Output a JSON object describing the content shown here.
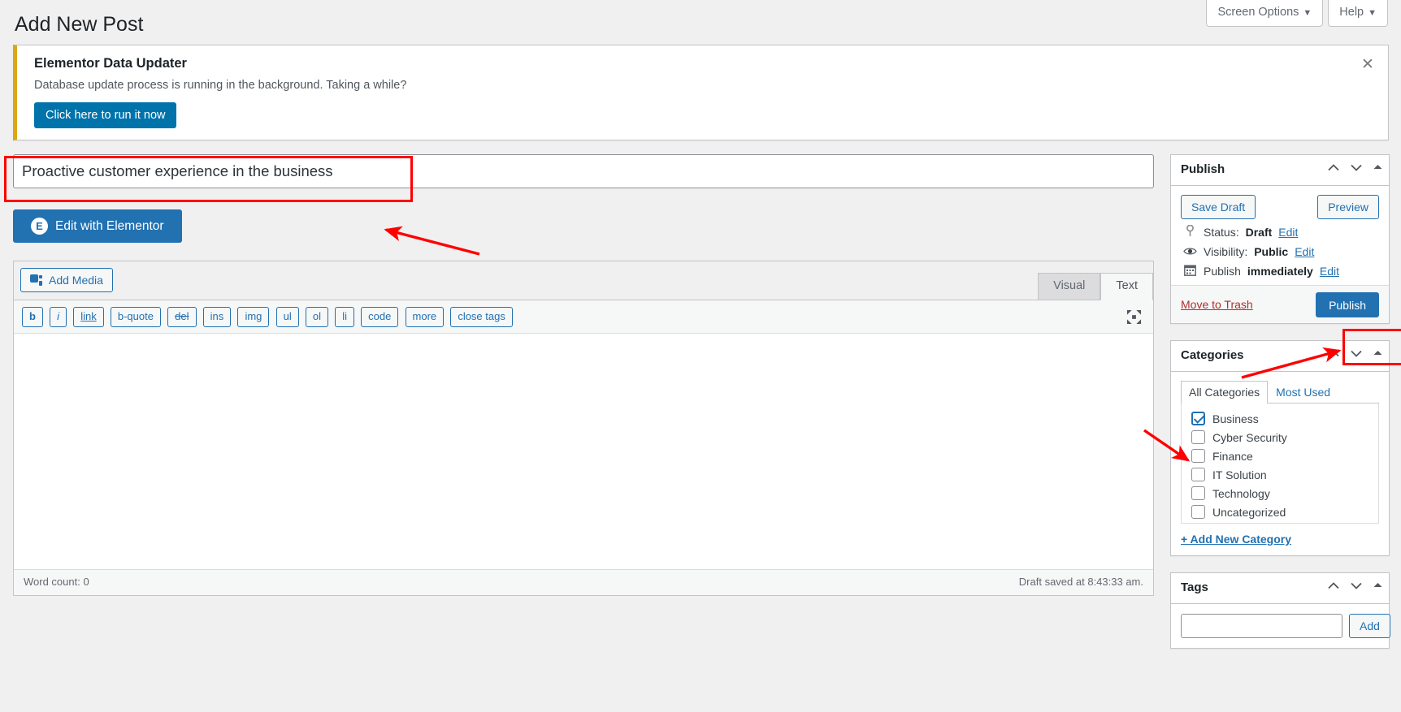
{
  "header": {
    "title": "Add New Post",
    "screen_options_label": "Screen Options",
    "help_label": "Help",
    "caret": "▼"
  },
  "notice": {
    "title": "Elementor Data Updater",
    "message": "Database update process is running in the background. Taking a while?",
    "button_label": "Click here to run it now",
    "close_glyph": "✕",
    "accent_color": "#dba617"
  },
  "post": {
    "title_value": "Proactive customer experience in the business",
    "title_placeholder": "Add title",
    "elementor_button_label": "Edit with Elementor",
    "elementor_badge": "E"
  },
  "editor": {
    "add_media_label": "Add Media",
    "tabs": [
      {
        "label": "Visual",
        "active": false
      },
      {
        "label": "Text",
        "active": true
      }
    ],
    "quicktags": [
      {
        "label": "b",
        "style": "b"
      },
      {
        "label": "i",
        "style": "i"
      },
      {
        "label": "link",
        "style": "u"
      },
      {
        "label": "b-quote",
        "style": ""
      },
      {
        "label": "del",
        "style": "s"
      },
      {
        "label": "ins",
        "style": ""
      },
      {
        "label": "img",
        "style": ""
      },
      {
        "label": "ul",
        "style": ""
      },
      {
        "label": "ol",
        "style": ""
      },
      {
        "label": "li",
        "style": ""
      },
      {
        "label": "code",
        "style": ""
      },
      {
        "label": "more",
        "style": ""
      },
      {
        "label": "close tags",
        "style": ""
      }
    ],
    "content_value": "",
    "word_count": "Word count: 0",
    "draft_saved": "Draft saved at 8:43:33 am.",
    "fullscreen_icon": "fullscreen-icon"
  },
  "publish_box": {
    "title": "Publish",
    "save_draft_label": "Save Draft",
    "preview_label": "Preview",
    "status_label": "Status:",
    "status_value": "Draft",
    "status_edit": "Edit",
    "visibility_label": "Visibility:",
    "visibility_value": "Public",
    "visibility_edit": "Edit",
    "schedule_label": "Publish",
    "schedule_value": "immediately",
    "schedule_edit": "Edit",
    "trash_label": "Move to Trash",
    "publish_label": "Publish"
  },
  "categories_box": {
    "title": "Categories",
    "tabs": [
      {
        "label": "All Categories",
        "active": true
      },
      {
        "label": "Most Used",
        "active": false
      }
    ],
    "items": [
      {
        "label": "Business",
        "checked": true
      },
      {
        "label": "Cyber Security",
        "checked": false
      },
      {
        "label": "Finance",
        "checked": false
      },
      {
        "label": "IT Solution",
        "checked": false
      },
      {
        "label": "Technology",
        "checked": false
      },
      {
        "label": "Uncategorized",
        "checked": false
      }
    ],
    "add_new_label": "+ Add New Category"
  },
  "tags_box": {
    "title": "Tags",
    "input_value": "",
    "add_label": "Add"
  },
  "panel_controls": {
    "up": "︿",
    "down": "﹀",
    "toggle": "▲"
  },
  "annotation": {
    "color": "#ff0000"
  }
}
